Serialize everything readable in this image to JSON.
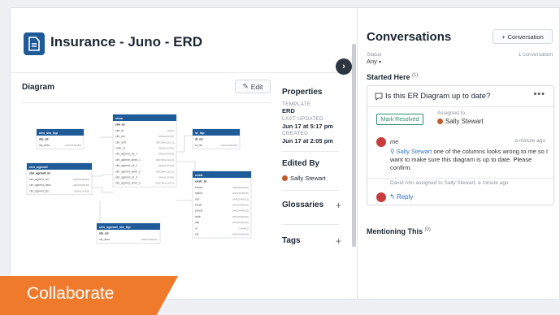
{
  "header": {
    "title": "Insurance - Juno - ERD"
  },
  "diagram": {
    "label": "Diagram",
    "edit_label": "Edit"
  },
  "erd": {
    "tables": [
      {
        "name": "clm_sts_lkp",
        "pk": "sts_cd",
        "fields": [
          [
            "sts_desc",
            "VARCHAR(45)"
          ]
        ]
      },
      {
        "name": "clm_agrmnt",
        "pk": "clm_agrmnt_id",
        "fields": [
          [
            "clm_agrmnt_nm",
            "VARCHAR(45)"
          ],
          [
            "clm_agrmnt_desc",
            "VARCHAR(45)"
          ],
          [
            "clm_agrmnt_sts",
            "SMALLINT(5)"
          ]
        ]
      },
      {
        "name": "clms",
        "pk": "clm_id",
        "fields": [
          [
            "clm_dt",
            "DATE"
          ],
          [
            "clm_sts",
            "SMALLINT(5)"
          ],
          [
            "clm_amt",
            "DECIMAL(10,2)"
          ],
          [
            "custr_id",
            "SMALLINT(5)"
          ],
          [
            "clm_agrmnt_cd_1",
            "SMALLINT(5)"
          ],
          [
            "clm_agrmnt_amnt_1",
            "DECIMAL(10,2)"
          ],
          [
            "clm_agrmnt_cd_2",
            "SMALLINT(5)"
          ],
          [
            "clm_agrmnt_amnt_2",
            "DECIMAL(10,2)"
          ],
          [
            "clm_agrmnt_cd_3",
            "SMALLINT(5)"
          ],
          [
            "clm_agrmnt_amnt_3",
            "DECIMAL(10,2)"
          ]
        ]
      },
      {
        "name": "st_lkp",
        "pk": "st_cd",
        "fields": [
          [
            "st_nm",
            "VARCHAR(45)"
          ]
        ]
      },
      {
        "name": "custr",
        "pk": "custr_id",
        "fields": [
          [
            "fname",
            "VARCHAR(45)"
          ],
          [
            "lname",
            "VARCHAR(45)"
          ],
          [
            "ssn",
            "VARCHAR(11)"
          ],
          [
            "email",
            "VARCHAR(45)"
          ],
          [
            "phone",
            "VARCHAR(15)"
          ],
          [
            "addr",
            "VARCHAR(45)"
          ],
          [
            "city",
            "VARCHAR(45)"
          ],
          [
            "st",
            "CHAR(2)"
          ],
          [
            "zip",
            "VARCHAR(10)"
          ]
        ]
      },
      {
        "name": "clm_agrmnt_sts_lkp",
        "pk": "sts_cd",
        "fields": [
          [
            "sts_desc",
            "VARCHAR(45)"
          ]
        ]
      }
    ]
  },
  "properties": {
    "heading": "Properties",
    "template_label": "TEMPLATE",
    "template_value": "ERD",
    "updated_label": "LAST UPDATED",
    "updated_value": "Jun 17 at 5:17 pm",
    "created_label": "CREATED",
    "created_value": "Jun 17 at 2:05 pm",
    "edited_by_heading": "Edited By",
    "edited_by_user": "Sally Stewart",
    "glossaries_heading": "Glossaries",
    "tags_heading": "Tags"
  },
  "conversations": {
    "title": "Conversations",
    "new_button": "Conversation",
    "status_label": "Status",
    "status_value": "Any",
    "count": "1 conversation",
    "started_heading": "Started Here",
    "started_count": "(1)",
    "mentioning_heading": "Mentioning This",
    "mentioning_count": "(0)",
    "card": {
      "question": "Is this ER Diagram up to date?",
      "mark_resolved": "Mark Resolved",
      "assigned_label": "Assigned to",
      "assigned_user": "Sally Stewart",
      "comment_author": "me",
      "comment_time": "a minute ago",
      "mention": "Sally Stewart",
      "comment_text": " one of the columns looks wrong to me so I want to make sure this diagram is up to date. Please confirm.",
      "assign_note": "David Ahn assigned to Sally Stewart, a minute ago",
      "reply_label": "Reply"
    }
  },
  "banner": {
    "label": "Collaborate"
  },
  "colors": {
    "brand_blue": "#1f5b98",
    "accent_orange": "#f07a2c",
    "link_blue": "#2f73c4",
    "resolve_green": "#2f8f6a"
  }
}
